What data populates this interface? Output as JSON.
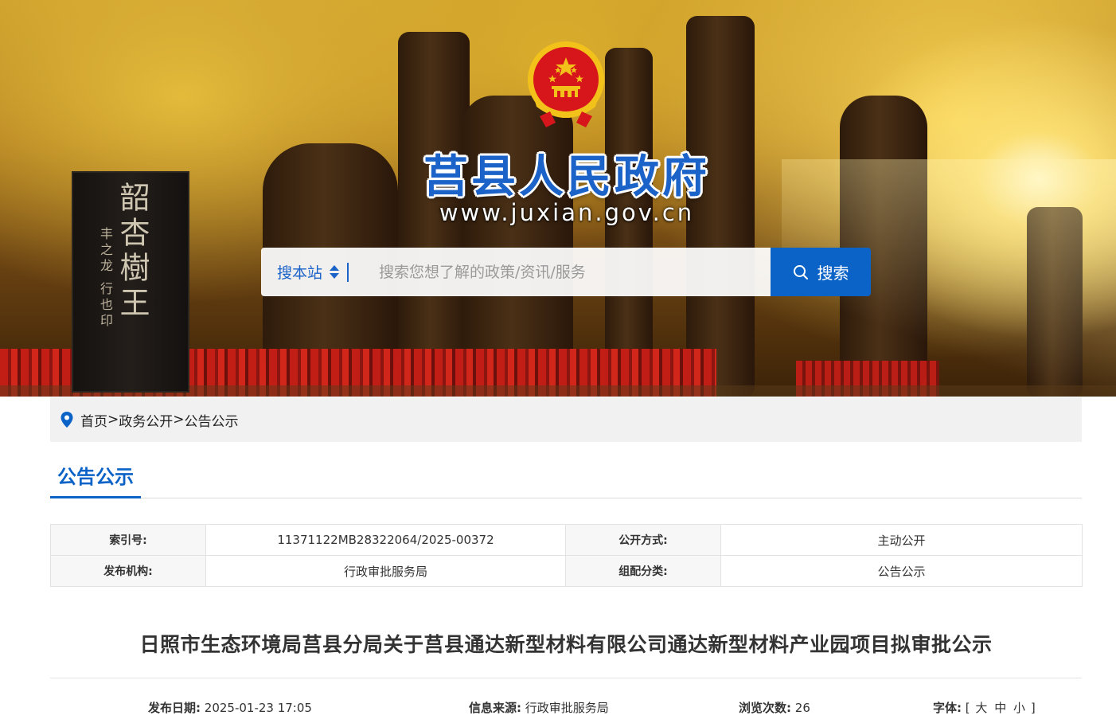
{
  "header": {
    "site_title": "莒县人民政府",
    "site_url": "www.juxian.gov.cn",
    "stele_title": "韶杏樹王",
    "stele_sub": "丰之龙 行也印"
  },
  "search": {
    "scope_label": "搜本站",
    "placeholder": "搜索您想了解的政策/资讯/服务",
    "button_label": "搜索"
  },
  "breadcrumb": {
    "items": [
      "首页",
      "政务公开",
      "公告公示"
    ],
    "separator": ">"
  },
  "section": {
    "title": "公告公示"
  },
  "meta": {
    "index_label": "索引号:",
    "index_value": "11371122MB28322064/2025-00372",
    "mode_label": "公开方式:",
    "mode_value": "主动公开",
    "org_label": "发布机构:",
    "org_value": "行政审批服务局",
    "cat_label": "组配分类:",
    "cat_value": "公告公示"
  },
  "article": {
    "title": "日照市生态环境局莒县分局关于莒县通达新型材料有限公司通达新型材料产业园项目拟审批公示",
    "date_label": "发布日期:",
    "date_value": "2025-01-23 17:05",
    "source_label": "信息来源:",
    "source_value": "行政审批服务局",
    "views_label": "浏览次数:",
    "views_value": "26",
    "font_label": "字体:",
    "font_open": "[",
    "font_large": "大",
    "font_medium": "中",
    "font_small": "小",
    "font_close": "]"
  },
  "colors": {
    "brand_blue": "#0b63c7",
    "title_blue": "#1b63c8",
    "emblem_red": "#d7161c",
    "emblem_gold": "#f2c21b"
  },
  "icons": [
    "national-emblem-icon",
    "location-pin-icon",
    "search-icon",
    "scope-toggle-icon"
  ]
}
